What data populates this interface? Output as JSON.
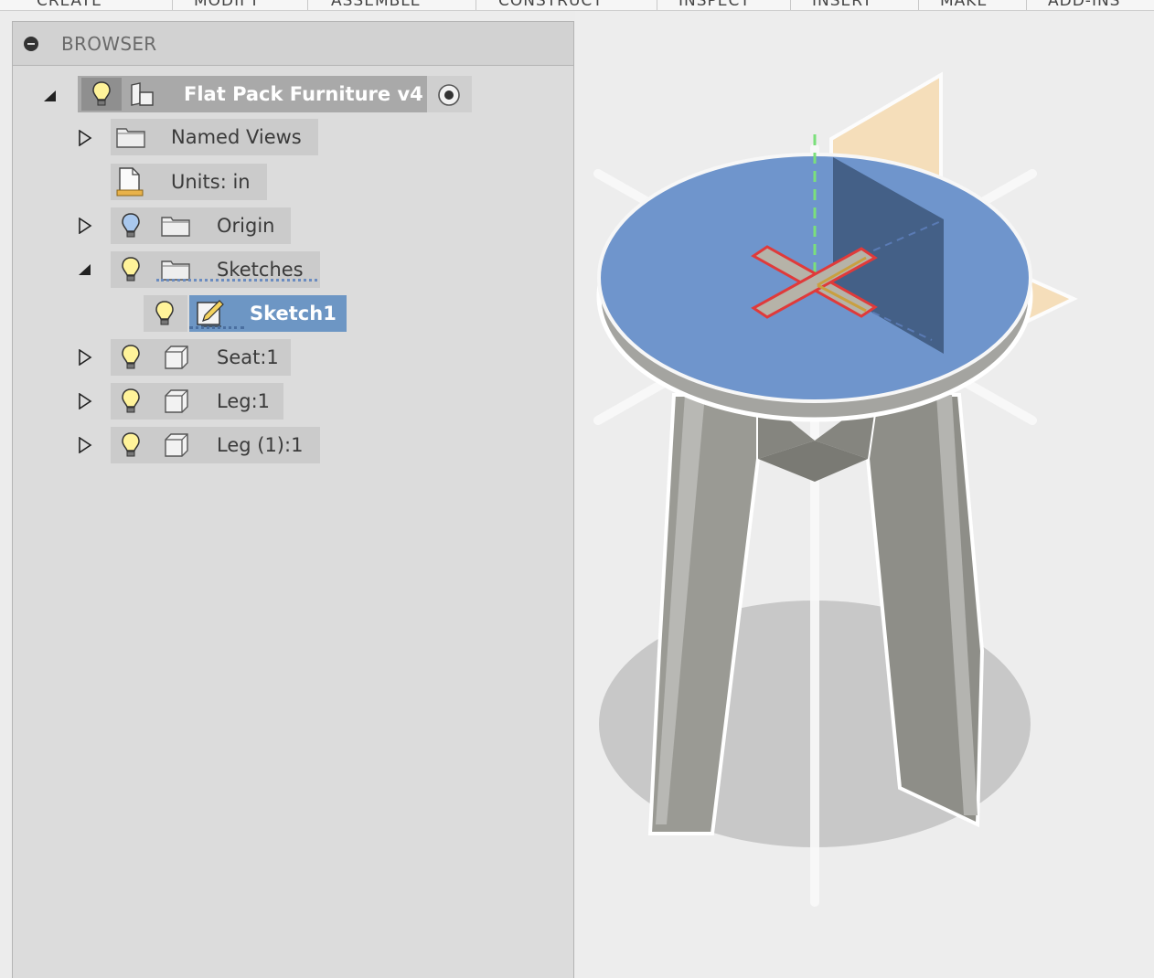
{
  "toolbar": {
    "tabs": [
      "CREATE",
      "MODIFY",
      "ASSEMBLE",
      "CONSTRUCT",
      "INSPECT",
      "INSERT",
      "MAKE",
      "ADD-INS"
    ]
  },
  "browser": {
    "title": "BROWSER",
    "root": {
      "label": "Flat Pack Furniture v4"
    },
    "items": [
      {
        "label": "Named Views",
        "icon": "folder-icon"
      },
      {
        "label": "Units: in",
        "icon": "document-ruler-icon"
      },
      {
        "label": "Origin",
        "icon": "folder-icon"
      },
      {
        "label": "Sketches",
        "icon": "folder-icon"
      },
      {
        "label": "Sketch1",
        "icon": "sketch-icon"
      },
      {
        "label": "Seat:1",
        "icon": "body-icon"
      },
      {
        "label": "Leg:1",
        "icon": "body-icon"
      },
      {
        "label": "Leg (1):1",
        "icon": "body-icon"
      }
    ]
  },
  "colors": {
    "selection": "#6d96c4",
    "seat_top": "#6f95cc",
    "sketch_outline": "#e03a3a",
    "plane": "#f6dcb0"
  }
}
